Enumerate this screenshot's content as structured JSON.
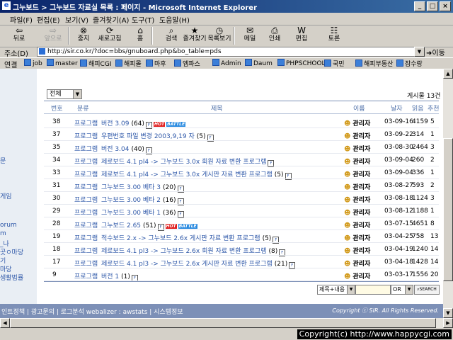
{
  "window": {
    "title": "그누보드 > 그누보드 자료실 목록 : 페이지 - Microsoft Internet Explorer",
    "buttons": [
      "_",
      "□",
      "×"
    ]
  },
  "menu": [
    "파일(F)",
    "편집(E)",
    "보기(V)",
    "즐겨찾기(A)",
    "도구(T)",
    "도움말(H)"
  ],
  "toolbar": [
    {
      "label": "뒤로",
      "icon": "back-arrow-icon",
      "glyph": "⇦"
    },
    {
      "label": "앞으로",
      "icon": "forward-arrow-icon",
      "glyph": "⇨"
    },
    {
      "label": "중지",
      "icon": "stop-icon",
      "glyph": "⊗"
    },
    {
      "label": "새로고침",
      "icon": "refresh-icon",
      "glyph": "⟳"
    },
    {
      "label": "홈",
      "icon": "home-icon",
      "glyph": "⌂"
    },
    {
      "label": "검색",
      "icon": "search-icon",
      "glyph": "⌕"
    },
    {
      "label": "즐겨찾기",
      "icon": "favorites-icon",
      "glyph": "★"
    },
    {
      "label": "목록보기",
      "icon": "history-icon",
      "glyph": "◷"
    },
    {
      "label": "메일",
      "icon": "mail-icon",
      "glyph": "✉"
    },
    {
      "label": "인쇄",
      "icon": "print-icon",
      "glyph": "⎙"
    },
    {
      "label": "편집",
      "icon": "edit-icon",
      "glyph": "W"
    },
    {
      "label": "토론",
      "icon": "discuss-icon",
      "glyph": "☷"
    }
  ],
  "address": {
    "label": "주소(D)",
    "url": "http://sir.co.kr/?doc=bbs/gnuboard.php&bo_table=pds",
    "go": "이동"
  },
  "links": {
    "label": "연결",
    "items": [
      "job",
      "master",
      "해피CGI",
      "해피몰",
      "마후",
      "엠파스",
      "Admin",
      "Daum",
      "PHPSCHOOL",
      "국민",
      "해피부동산",
      "잡수랑"
    ]
  },
  "sidebar": [
    "문",
    "게임",
    "orum",
    "m",
    "_나",
    "곳ㅇ마당",
    "기",
    "마당",
    "생활법률"
  ],
  "board": {
    "category_select": "전체",
    "total": "게시물 13건",
    "headers": {
      "no": "번호",
      "cat": "분류",
      "title": "제목",
      "name": "이름",
      "date": "날자",
      "views": "읽음",
      "rec": "추천"
    },
    "rows": [
      {
        "no": "38",
        "cat": "프로그램",
        "title": "버전 3.09",
        "count": "(64)",
        "file": true,
        "hot": true,
        "new": true,
        "name": "관리자",
        "date": "03-09-16",
        "views": "4159",
        "rec": "5"
      },
      {
        "no": "37",
        "cat": "프로그램",
        "title": "우편번호 파일 변경 2003,9,19 자",
        "count": "(5)",
        "file": true,
        "hot": false,
        "new": false,
        "name": "관리자",
        "date": "03-09-22",
        "views": "314",
        "rec": "1"
      },
      {
        "no": "35",
        "cat": "프로그램",
        "title": "버전 3.04",
        "count": "(40)",
        "file": true,
        "hot": false,
        "new": false,
        "name": "관리자",
        "date": "03-08-30",
        "views": "2464",
        "rec": "3"
      },
      {
        "no": "34",
        "cat": "프로그램",
        "title": "제로보드 4.1 pl4 -> 그누보드 3.0x 회원 자료 변환 프로그램",
        "count": "",
        "file": true,
        "hot": false,
        "new": false,
        "name": "관리자",
        "date": "03-09-04",
        "views": "260",
        "rec": "2"
      },
      {
        "no": "33",
        "cat": "프로그램",
        "title": "제로보드 4.1 pl4 -> 그누보드 3.0x 게시판 자료 변환 프로그램",
        "count": "(5)",
        "file": true,
        "hot": false,
        "new": false,
        "name": "관리자",
        "date": "03-09-04",
        "views": "336",
        "rec": "1"
      },
      {
        "no": "31",
        "cat": "프로그램",
        "title": "그누보드 3.00 베타 3",
        "count": "(20)",
        "file": true,
        "hot": false,
        "new": false,
        "name": "관리자",
        "date": "03-08-27",
        "views": "593",
        "rec": "2"
      },
      {
        "no": "30",
        "cat": "프로그램",
        "title": "그누보드 3.00 베타 2",
        "count": "(16)",
        "file": true,
        "hot": false,
        "new": false,
        "name": "관리자",
        "date": "03-08-18",
        "views": "1124",
        "rec": "3"
      },
      {
        "no": "29",
        "cat": "프로그램",
        "title": "그누보드 3.00 베타 1",
        "count": "(36)",
        "file": true,
        "hot": false,
        "new": false,
        "name": "관리자",
        "date": "03-08-12",
        "views": "1188",
        "rec": "1"
      },
      {
        "no": "28",
        "cat": "프로그램",
        "title": "그누보드 2.65",
        "count": "(51)",
        "file": true,
        "hot": true,
        "new": true,
        "name": "관리자",
        "date": "03-07-15",
        "views": "4651",
        "rec": "8"
      },
      {
        "no": "19",
        "cat": "프로그램",
        "title": "적수보드 2.x -> 그누보드 2.6x 게시판 자료 변환 프로그램",
        "count": "(5)",
        "file": true,
        "hot": false,
        "new": false,
        "name": "관리자",
        "date": "03-04-25",
        "views": "758",
        "rec": "13"
      },
      {
        "no": "18",
        "cat": "프로그램",
        "title": "제로보드 4.1 pl3 -> 그누보드 2.6x 회원 자료 변환 프로그램",
        "count": "(8)",
        "file": true,
        "hot": false,
        "new": false,
        "name": "관리자",
        "date": "03-04-19",
        "views": "1240",
        "rec": "14"
      },
      {
        "no": "17",
        "cat": "프로그램",
        "title": "제로보드 4.1 pl3 -> 그누보드 2.6x 게시판 자료 변환 프로그램",
        "count": "(21)",
        "file": true,
        "hot": false,
        "new": false,
        "name": "관리자",
        "date": "03-04-18",
        "views": "1428",
        "rec": "14"
      },
      {
        "no": "9",
        "cat": "프로그램",
        "title": "버전 1",
        "count": "(1)",
        "file": true,
        "hot": false,
        "new": false,
        "name": "관리자",
        "date": "03-03-17",
        "views": "1556",
        "rec": "20"
      }
    ],
    "search": {
      "field": "제목+내용",
      "op": "OR",
      "button": "SEARCH"
    }
  },
  "footer": {
    "left": "인트정책 | 광고문의 | 로그분석 webalizer : awstats | 시스템정보",
    "right": "Copyright ⓒ SIR. All Rights Reserved."
  },
  "status": {
    "copyright": "Copyright(c) http://www.happycgi.com"
  }
}
